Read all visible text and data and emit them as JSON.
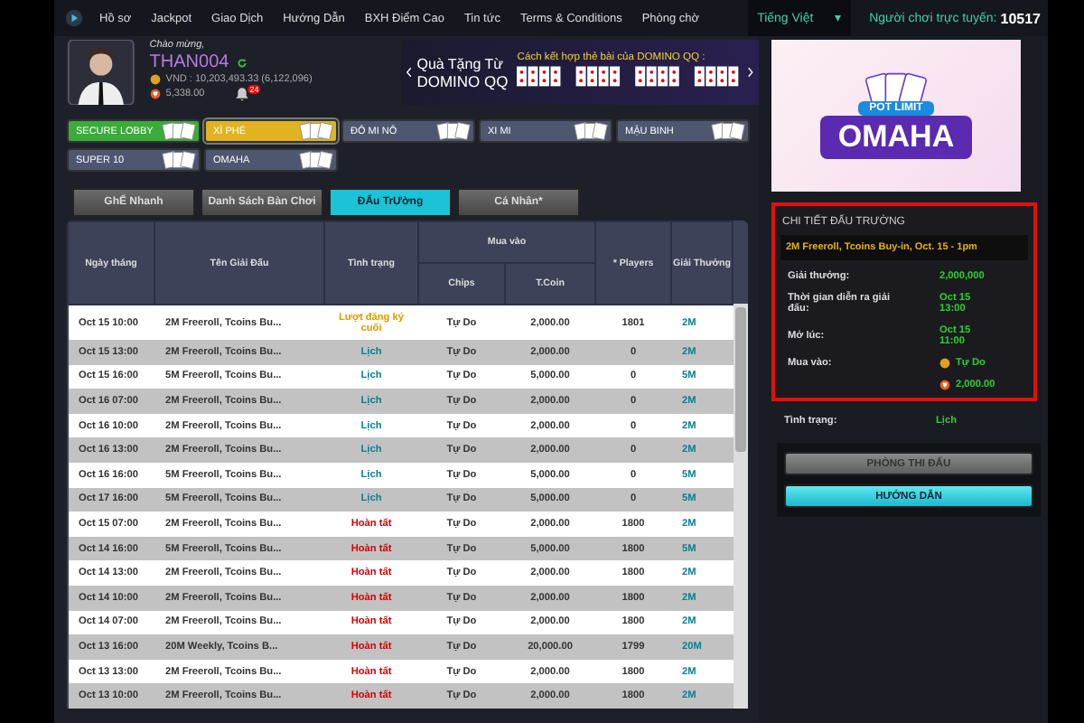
{
  "nav": {
    "items": [
      "Hồ sơ",
      "Jackpot",
      "Giao Dịch",
      "Hướng Dẫn",
      "BXH Điểm Cao",
      "Tin tức",
      "Terms & Conditions",
      "Phòng chờ"
    ],
    "language": "Tiếng Việt",
    "language_caret": "▾",
    "online_label": "Người chơi trực tuyến:",
    "online_count": "10517"
  },
  "profile": {
    "welcome": "Chào mừng,",
    "username": "THAN004",
    "balance": "VND : 10,203,493.33 (6,122,096)",
    "points": "5,338.00",
    "notifications": "24"
  },
  "banner": {
    "line1": "Quà Tặng Từ",
    "line2": "DOMINO QQ",
    "caption": "Cách kết hợp thẻ bài của DOMINO QQ :"
  },
  "lobbies": [
    {
      "label": "SECURE LOBBY",
      "selected": false,
      "color": "#3bab3b"
    },
    {
      "label": "XÌ PHÉ",
      "selected": true,
      "color": "#e2b320"
    },
    {
      "label": "ĐÔ MI NÔ",
      "selected": false,
      "color": "#4f5670"
    },
    {
      "label": "XI MI",
      "selected": false,
      "color": "#4f5670"
    },
    {
      "label": "MẬU BINH",
      "selected": false,
      "color": "#4f5670"
    },
    {
      "label": "SUPER 10",
      "selected": false,
      "color": "#4f5670"
    },
    {
      "label": "OMAHA",
      "selected": false,
      "color": "#4f5670"
    }
  ],
  "tabs": [
    {
      "label": "GhẾ Nhanh",
      "selected": false
    },
    {
      "label": "Danh Sách Bàn Chơi",
      "selected": false
    },
    {
      "label": "ĐẤu TrƯờng",
      "selected": true
    },
    {
      "label": "Cá Nhân*",
      "selected": false
    }
  ],
  "table": {
    "columns": {
      "date": "Ngày tháng",
      "name": "Tên Giải Đấu",
      "status": "Tình trạng",
      "buyin": "Mua vào",
      "chips": "Chips",
      "tcoin": "T.Coin",
      "players": "* Players",
      "prize": "Giải Thưởng"
    },
    "rows": [
      {
        "date": "Oct 15 10:00",
        "name": "2M Freeroll, Tcoins Bu...",
        "status": "Lượt đăng ký cuối",
        "kind": "late",
        "chips": "Tự Do",
        "tcoin": "2,000.00",
        "players": "1801",
        "prize": "2M"
      },
      {
        "date": "Oct 15 13:00",
        "name": "2M Freeroll, Tcoins Bu...",
        "status": "Lịch",
        "kind": "scheduled",
        "chips": "Tự Do",
        "tcoin": "2,000.00",
        "players": "0",
        "prize": "2M"
      },
      {
        "date": "Oct 15 16:00",
        "name": "5M Freeroll, Tcoins Bu...",
        "status": "Lịch",
        "kind": "scheduled",
        "chips": "Tự Do",
        "tcoin": "5,000.00",
        "players": "0",
        "prize": "5M"
      },
      {
        "date": "Oct 16 07:00",
        "name": "2M Freeroll, Tcoins Bu...",
        "status": "Lịch",
        "kind": "scheduled",
        "chips": "Tự Do",
        "tcoin": "2,000.00",
        "players": "0",
        "prize": "2M"
      },
      {
        "date": "Oct 16 10:00",
        "name": "2M Freeroll, Tcoins Bu...",
        "status": "Lịch",
        "kind": "scheduled",
        "chips": "Tự Do",
        "tcoin": "2,000.00",
        "players": "0",
        "prize": "2M"
      },
      {
        "date": "Oct 16 13:00",
        "name": "2M Freeroll, Tcoins Bu...",
        "status": "Lịch",
        "kind": "scheduled",
        "chips": "Tự Do",
        "tcoin": "2,000.00",
        "players": "0",
        "prize": "2M"
      },
      {
        "date": "Oct 16 16:00",
        "name": "5M Freeroll, Tcoins Bu...",
        "status": "Lịch",
        "kind": "scheduled",
        "chips": "Tự Do",
        "tcoin": "5,000.00",
        "players": "0",
        "prize": "5M"
      },
      {
        "date": "Oct 17 16:00",
        "name": "5M Freeroll, Tcoins Bu...",
        "status": "Lịch",
        "kind": "scheduled",
        "chips": "Tự Do",
        "tcoin": "5,000.00",
        "players": "0",
        "prize": "5M"
      },
      {
        "date": "Oct 15 07:00",
        "name": "2M Freeroll, Tcoins Bu...",
        "status": "Hoàn tất",
        "kind": "finished",
        "chips": "Tự Do",
        "tcoin": "2,000.00",
        "players": "1800",
        "prize": "2M"
      },
      {
        "date": "Oct 14 16:00",
        "name": "5M Freeroll, Tcoins Bu...",
        "status": "Hoàn tất",
        "kind": "finished",
        "chips": "Tự Do",
        "tcoin": "5,000.00",
        "players": "1800",
        "prize": "5M"
      },
      {
        "date": "Oct 14 13:00",
        "name": "2M Freeroll, Tcoins Bu...",
        "status": "Hoàn tất",
        "kind": "finished",
        "chips": "Tự Do",
        "tcoin": "2,000.00",
        "players": "1800",
        "prize": "2M"
      },
      {
        "date": "Oct 14 10:00",
        "name": "2M Freeroll, Tcoins Bu...",
        "status": "Hoàn tất",
        "kind": "finished",
        "chips": "Tự Do",
        "tcoin": "2,000.00",
        "players": "1800",
        "prize": "2M"
      },
      {
        "date": "Oct 14 07:00",
        "name": "2M Freeroll, Tcoins Bu...",
        "status": "Hoàn tất",
        "kind": "finished",
        "chips": "Tự Do",
        "tcoin": "2,000.00",
        "players": "1800",
        "prize": "2M"
      },
      {
        "date": "Oct 13 16:00",
        "name": "20M Weekly, Tcoins B...",
        "status": "Hoàn tất",
        "kind": "finished",
        "chips": "Tự Do",
        "tcoin": "20,000.00",
        "players": "1799",
        "prize": "20M"
      },
      {
        "date": "Oct 13 13:00",
        "name": "2M Freeroll, Tcoins Bu...",
        "status": "Hoàn tất",
        "kind": "finished",
        "chips": "Tự Do",
        "tcoin": "2,000.00",
        "players": "1800",
        "prize": "2M"
      },
      {
        "date": "Oct 13 10:00",
        "name": "2M Freeroll, Tcoins Bu...",
        "status": "Hoàn tất",
        "kind": "finished",
        "chips": "Tự Do",
        "tcoin": "2,000.00",
        "players": "1800",
        "prize": "2M"
      }
    ]
  },
  "ad": {
    "tag": "POT LIMIT",
    "title": "OMAHA"
  },
  "details": {
    "title": "CHI TIẾT ĐẤU TRƯỜNG",
    "event": "2M Freeroll, Tcoins Buy-in, Oct. 15 - 1pm",
    "prize_label": "Giải thưởng:",
    "prize": "2,000,000",
    "time_label": "Thời gian diễn ra giải đấu:",
    "time": "Oct 15 13:00",
    "open_label": "Mở lúc:",
    "open": "Oct 15 11:00",
    "buyin_label": "Mua vào:",
    "buyin_chips": "Tự Do",
    "buyin_tcoin": "2,000.00"
  },
  "status": {
    "label": "Tình trạng:",
    "value": "Lịch"
  },
  "buttons": [
    "PHÒNG THI ĐẤU",
    "HƯỚNG DẪN"
  ]
}
